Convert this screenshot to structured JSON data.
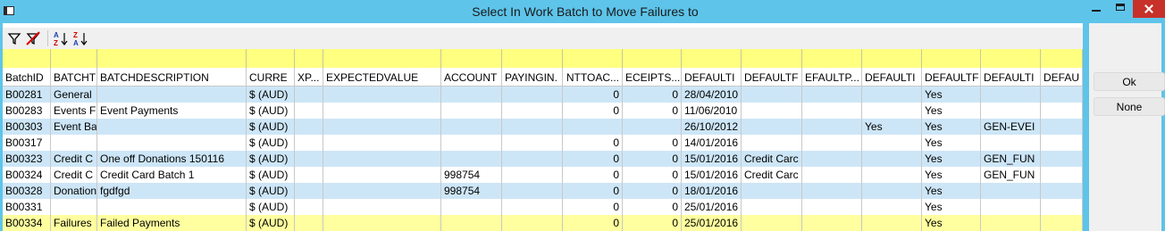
{
  "window": {
    "title": "Select In Work Batch to Move Failures to",
    "controls": [
      "minimize-icon",
      "maximize-icon",
      "close-icon"
    ]
  },
  "toolbar": {
    "icons": [
      "filter-icon",
      "clear-filter-icon",
      "sort-ascending-icon",
      "sort-descending-icon"
    ],
    "sort_asc_label": "AZ",
    "sort_desc_label": "ZA"
  },
  "buttons": {
    "ok": "Ok",
    "none": "None"
  },
  "grid": {
    "headers": [
      "BatchID",
      "BATCHT",
      "BATCHDESCRIPTION",
      "CURRE",
      "XP...",
      "EXPECTEDVALUE",
      "ACCOUNT",
      "PAYINGIN.",
      "NTTOAC...",
      "ECEIPTS...",
      "DEFAULTI",
      "DEFAULTF",
      "EFAULTP...",
      "DEFAULTI",
      "DEFAULTF",
      "DEFAULTI",
      "DEFAU"
    ],
    "rows": [
      [
        "B00281",
        "General",
        "",
        "$ (AUD)",
        "",
        "",
        "",
        "",
        "0",
        "0",
        "28/04/2010",
        "",
        "",
        "",
        "Yes",
        "",
        ""
      ],
      [
        "B00283",
        "Events F",
        "Event Payments",
        "$ (AUD)",
        "",
        "",
        "",
        "",
        "0",
        "0",
        "11/06/2010",
        "",
        "",
        "",
        "Yes",
        "",
        ""
      ],
      [
        "B00303",
        "Event Ba",
        "",
        "$ (AUD)",
        "",
        "",
        "",
        "",
        "",
        "",
        "26/10/2012",
        "",
        "",
        "Yes",
        "Yes",
        "GEN-EVEI",
        ""
      ],
      [
        "B00317",
        "",
        "",
        "$ (AUD)",
        "",
        "",
        "",
        "",
        "0",
        "0",
        "14/01/2016",
        "",
        "",
        "",
        "Yes",
        "",
        ""
      ],
      [
        "B00323",
        "Credit C",
        "One off Donations 150116",
        "$ (AUD)",
        "",
        "",
        "",
        "",
        "0",
        "0",
        "15/01/2016",
        "Credit Carc",
        "",
        "",
        "Yes",
        "GEN_FUN",
        ""
      ],
      [
        "B00324",
        "Credit C",
        "Credit Card Batch 1",
        "$ (AUD)",
        "",
        "",
        "998754",
        "",
        "0",
        "0",
        "15/01/2016",
        "Credit Carc",
        "",
        "",
        "Yes",
        "GEN_FUN",
        ""
      ],
      [
        "B00328",
        "Donation",
        "fgdfgd",
        "$ (AUD)",
        "",
        "",
        "998754",
        "",
        "0",
        "0",
        "18/01/2016",
        "",
        "",
        "",
        "Yes",
        "",
        ""
      ],
      [
        "B00331",
        "",
        "",
        "$ (AUD)",
        "",
        "",
        "",
        "",
        "0",
        "0",
        "25/01/2016",
        "",
        "",
        "",
        "Yes",
        "",
        ""
      ],
      [
        "B00334",
        "Failures",
        "Failed Payments",
        "$ (AUD)",
        "",
        "",
        "",
        "",
        "0",
        "0",
        "25/01/2016",
        "",
        "",
        "",
        "Yes",
        "",
        ""
      ]
    ]
  },
  "colors": {
    "titlebar": "#5ec4ea",
    "row_alt": "#cde6f7",
    "filter_row": "#ffff80",
    "selected_row": "#ffff9f",
    "close_button": "#c7312a"
  }
}
